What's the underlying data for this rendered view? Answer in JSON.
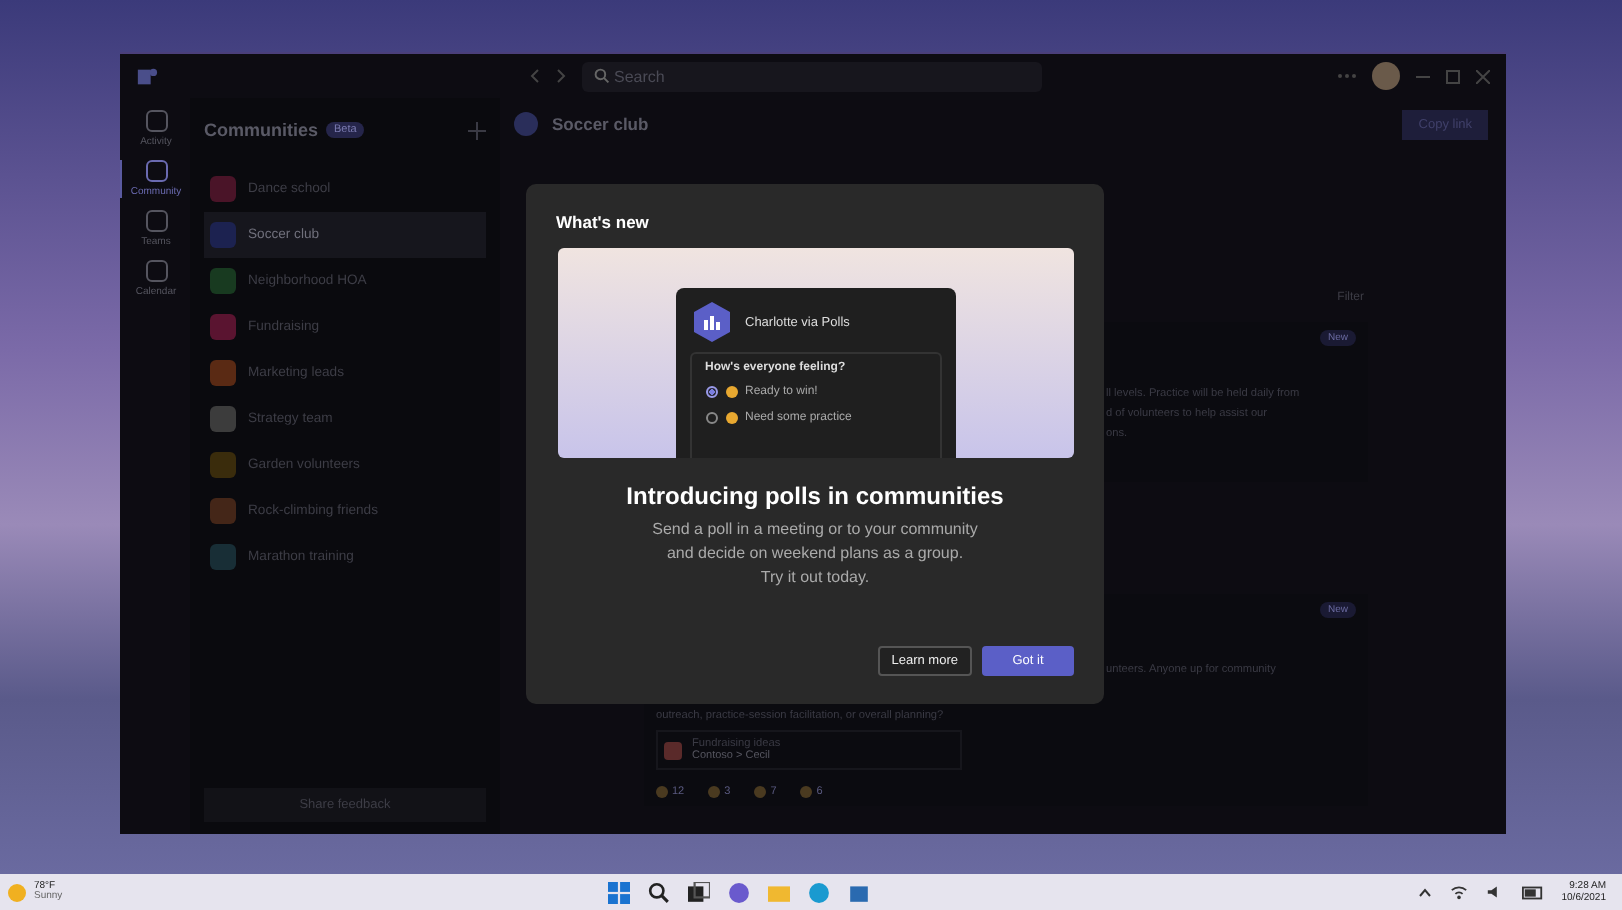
{
  "title_bar": {
    "search_placeholder": "Search"
  },
  "rail": [
    {
      "label": "Activity",
      "selected": false
    },
    {
      "label": "Community",
      "selected": true
    },
    {
      "label": "Teams",
      "selected": false
    },
    {
      "label": "Calendar",
      "selected": false
    }
  ],
  "communities": {
    "title": "Communities",
    "badge": "Beta",
    "items": [
      {
        "name": "Dance school",
        "color": "#4a1428",
        "selected": false
      },
      {
        "name": "Soccer club",
        "color": "#1c2250",
        "selected": true
      },
      {
        "name": "Neighborhood HOA",
        "color": "#183a20",
        "selected": false
      },
      {
        "name": "Fundraising",
        "color": "#5a1430",
        "selected": false
      },
      {
        "name": "Marketing leads",
        "color": "#5a2a14",
        "selected": false
      },
      {
        "name": "Strategy team",
        "color": "#3c3c3c",
        "selected": false
      },
      {
        "name": "Garden volunteers",
        "color": "#3a2c0c",
        "selected": false
      },
      {
        "name": "Rock-climbing friends",
        "color": "#442618",
        "selected": false
      },
      {
        "name": "Marathon training",
        "color": "#182e36",
        "selected": false
      }
    ],
    "feedback": "Share feedback"
  },
  "channel": {
    "title": "Soccer club",
    "copy_link": "Copy link",
    "filter": "Filter"
  },
  "posts": [
    {
      "badge": "New",
      "lines": [
        "ll levels. Practice will be held daily from",
        "d of volunteers to help assist our",
        "ons."
      ]
    },
    {
      "badge": "New",
      "lines": [
        "unteers. Anyone up for community"
      ],
      "below": "outreach, practice-session facilitation, or overall planning?",
      "attachment": {
        "title": "Fundraising ideas",
        "path": "Contoso > Cecil"
      },
      "reactions": [
        "12",
        "3",
        "7",
        "6"
      ]
    }
  ],
  "dialog": {
    "title": "What's new",
    "preview": {
      "sender": "Charlotte via Polls",
      "question": "How's everyone feeling?",
      "options": [
        {
          "label": "Ready to win!",
          "selected": true
        },
        {
          "label": "Need some practice",
          "selected": false
        }
      ]
    },
    "heading": "Introducing polls in communities",
    "body": [
      "Send a poll in a meeting or to your community",
      "and decide on weekend plans as a group.",
      "Try it out today."
    ],
    "buttons": [
      {
        "label": "Learn more",
        "kind": "secondary"
      },
      {
        "label": "Got it",
        "kind": "primary"
      }
    ]
  },
  "taskbar": {
    "temp": "78°F",
    "weather": "Sunny",
    "time": "9:28 AM",
    "date": "10/6/2021"
  }
}
